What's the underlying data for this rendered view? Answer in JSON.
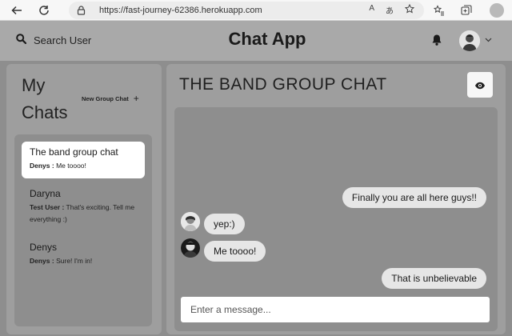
{
  "browser": {
    "url": "https://fast-journey-62386.herokuapp.com",
    "icons": [
      "back-icon",
      "reload-icon",
      "lock-icon",
      "read-aloud-icon",
      "translate-icon",
      "favorite-icon",
      "favorites-icon",
      "collections-icon",
      "profile-icon"
    ],
    "read_aloud_label": "A",
    "translate_label": "あ"
  },
  "header": {
    "search_label": "Search User",
    "title": "Chat App",
    "icons": [
      "search-icon",
      "bell-icon",
      "chevron-down-icon"
    ]
  },
  "sidebar": {
    "title": "My Chats",
    "new_group_label": "New Group Chat",
    "new_group_icon": "+",
    "chats": [
      {
        "name": "The band group chat",
        "sender": "Denys :",
        "message": "Me toooo!",
        "selected": true
      },
      {
        "name": "Daryna",
        "sender": "Test User :",
        "message": "That's exciting. Tell me everything :)",
        "selected": false
      },
      {
        "name": "Denys",
        "sender": "Denys :",
        "message": "Sure! I'm in!",
        "selected": false
      }
    ]
  },
  "chat": {
    "title": "THE BAND GROUP CHAT",
    "view_icon": "eye-icon",
    "messages": [
      {
        "text": "Finally you are all here guys!!",
        "side": "right"
      },
      {
        "text": "yep:)",
        "side": "left"
      },
      {
        "text": "Me toooo!",
        "side": "left"
      },
      {
        "text": "That is unbelievable",
        "side": "right"
      }
    ],
    "input_placeholder": "Enter a message..."
  },
  "colors": {
    "page_background": "#8e8e8e",
    "header_background": "#a9a9a9",
    "panel_background": "#9e9e9e",
    "bubble_background": "#e6e6e6",
    "selected_chat": "#ffffff"
  }
}
